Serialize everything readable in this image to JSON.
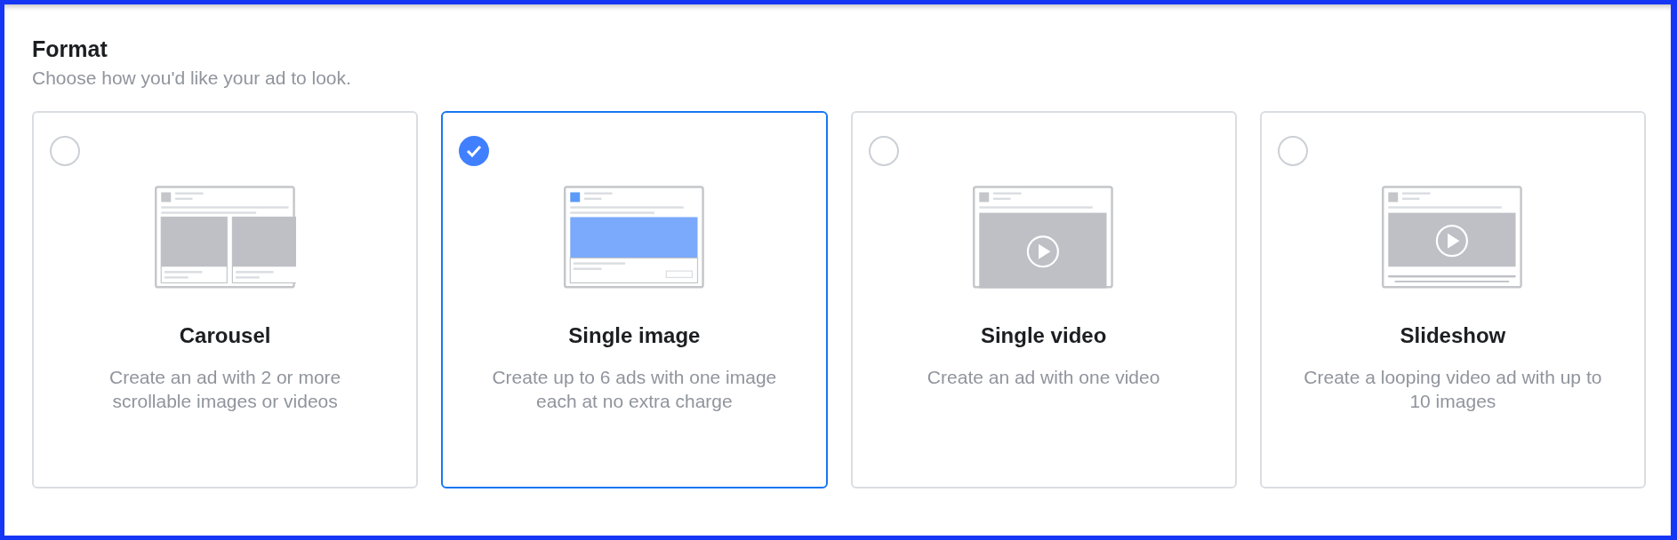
{
  "section": {
    "title": "Format",
    "subtitle": "Choose how you'd like your ad to look."
  },
  "options": [
    {
      "kind": "carousel",
      "title": "Carousel",
      "description": "Create an ad with 2 or more scrollable images or videos",
      "selected": false
    },
    {
      "kind": "image",
      "title": "Single image",
      "description": "Create up to 6 ads with one image each at no extra charge",
      "selected": true
    },
    {
      "kind": "video",
      "title": "Single video",
      "description": "Create an ad with one video",
      "selected": false
    },
    {
      "kind": "slideshow",
      "title": "Slideshow",
      "description": "Create a looping video ad with up to 10 images",
      "selected": false
    }
  ]
}
